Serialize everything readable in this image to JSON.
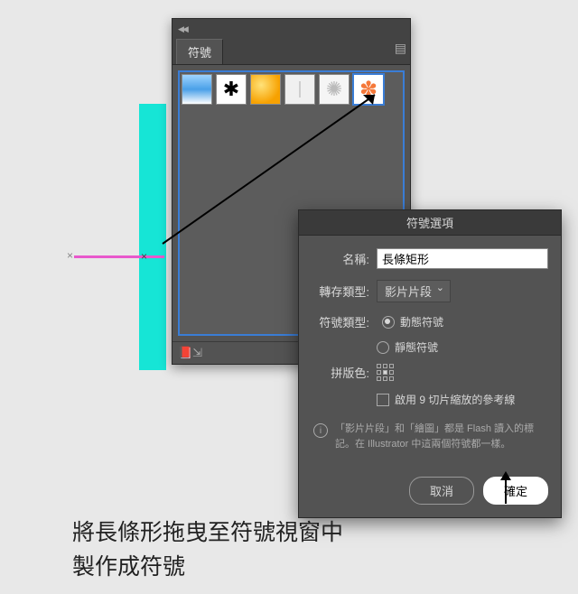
{
  "canvas": {
    "cyan_rect_name": "cyan-rectangle-shape"
  },
  "symbols_panel": {
    "tab_label": "符號",
    "swatches": [
      "gradient",
      "ink-splat",
      "orange-sphere",
      "ribbon",
      "wreath",
      "flower"
    ]
  },
  "dialog": {
    "title": "符號選項",
    "name_label": "名稱:",
    "name_value": "長條矩形",
    "export_label": "轉存類型:",
    "export_value": "影片片段",
    "type_label": "符號類型:",
    "type_dynamic": "動態符號",
    "type_static": "靜態符號",
    "type_selected": "dynamic",
    "registration_label": "拼版色:",
    "slice_checkbox": "啟用 9 切片縮放的參考線",
    "info_text": "「影片片段」和「繪圖」都是 Flash 讀入的標記。在 Illustrator 中這兩個符號都一樣。",
    "cancel": "取消",
    "ok": "確定"
  },
  "instruction": {
    "line1": "將長條形拖曳至符號視窗中",
    "line2": "製作成符號"
  }
}
